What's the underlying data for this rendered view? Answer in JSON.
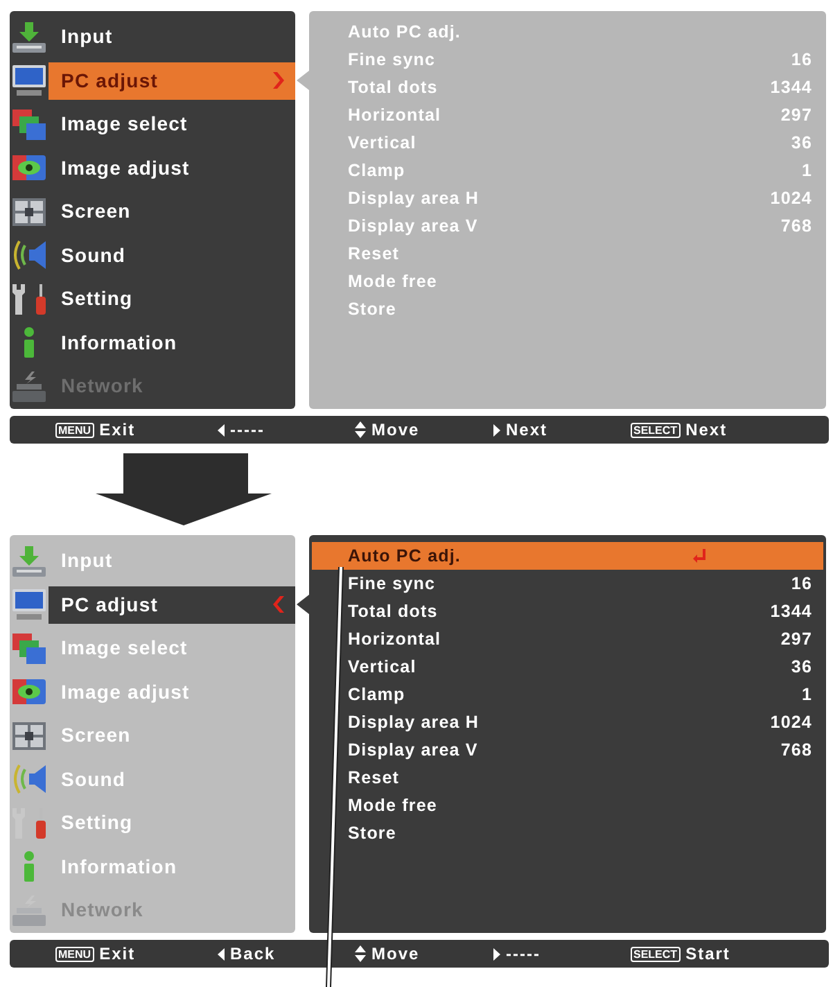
{
  "screens": [
    {
      "main_menu": {
        "active": true,
        "items": [
          {
            "label": "Input",
            "selected": false,
            "disabled": false
          },
          {
            "label": "PC adjust",
            "selected": true,
            "disabled": false
          },
          {
            "label": "Image select",
            "selected": false,
            "disabled": false
          },
          {
            "label": "Image adjust",
            "selected": false,
            "disabled": false
          },
          {
            "label": "Screen",
            "selected": false,
            "disabled": false
          },
          {
            "label": "Sound",
            "selected": false,
            "disabled": false
          },
          {
            "label": "Setting",
            "selected": false,
            "disabled": false
          },
          {
            "label": "Information",
            "selected": false,
            "disabled": false
          },
          {
            "label": "Network",
            "selected": false,
            "disabled": true
          }
        ]
      },
      "submenu": {
        "active": false,
        "items": [
          {
            "label": "Auto PC adj.",
            "selected": false
          },
          {
            "label": "Fine sync",
            "value": "16",
            "selected": false
          },
          {
            "label": "Total dots",
            "value": "1344",
            "selected": false
          },
          {
            "label": "Horizontal",
            "value": "297",
            "selected": false
          },
          {
            "label": "Vertical",
            "value": "36",
            "selected": false
          },
          {
            "label": "Clamp",
            "value": "1",
            "selected": false
          },
          {
            "label": "Display area H",
            "value": "1024",
            "selected": false
          },
          {
            "label": "Display area V",
            "value": "768",
            "selected": false
          },
          {
            "label": "Reset",
            "selected": false
          },
          {
            "label": "Mode free",
            "selected": false
          },
          {
            "label": "Store",
            "selected": false
          }
        ]
      },
      "status_bar": [
        {
          "kind": "key",
          "key": "MENU",
          "label": "Exit"
        },
        {
          "kind": "left",
          "label": "-----"
        },
        {
          "kind": "updown",
          "label": "Move"
        },
        {
          "kind": "right",
          "label": "Next"
        },
        {
          "kind": "key",
          "key": "SELECT",
          "label": "Next"
        }
      ]
    },
    {
      "main_menu": {
        "active": false,
        "items": [
          {
            "label": "Input",
            "selected": false,
            "disabled": false
          },
          {
            "label": "PC adjust",
            "selected": true,
            "disabled": false
          },
          {
            "label": "Image select",
            "selected": false,
            "disabled": false
          },
          {
            "label": "Image adjust",
            "selected": false,
            "disabled": false
          },
          {
            "label": "Screen",
            "selected": false,
            "disabled": false
          },
          {
            "label": "Sound",
            "selected": false,
            "disabled": false
          },
          {
            "label": "Setting",
            "selected": false,
            "disabled": false
          },
          {
            "label": "Information",
            "selected": false,
            "disabled": false
          },
          {
            "label": "Network",
            "selected": false,
            "disabled": true
          }
        ]
      },
      "submenu": {
        "active": true,
        "items": [
          {
            "label": "Auto PC adj.",
            "selected": true
          },
          {
            "label": "Fine sync",
            "value": "16",
            "selected": false
          },
          {
            "label": "Total dots",
            "value": "1344",
            "selected": false
          },
          {
            "label": "Horizontal",
            "value": "297",
            "selected": false
          },
          {
            "label": "Vertical",
            "value": "36",
            "selected": false
          },
          {
            "label": "Clamp",
            "value": "1",
            "selected": false
          },
          {
            "label": "Display area H",
            "value": "1024",
            "selected": false
          },
          {
            "label": "Display area V",
            "value": "768",
            "selected": false
          },
          {
            "label": "Reset",
            "selected": false
          },
          {
            "label": "Mode free",
            "selected": false
          },
          {
            "label": "Store",
            "selected": false
          }
        ]
      },
      "status_bar": [
        {
          "kind": "key",
          "key": "MENU",
          "label": "Exit"
        },
        {
          "kind": "left",
          "label": "Back"
        },
        {
          "kind": "updown",
          "label": "Move"
        },
        {
          "kind": "right",
          "label": "-----"
        },
        {
          "kind": "key",
          "key": "SELECT",
          "label": "Start"
        }
      ]
    }
  ]
}
